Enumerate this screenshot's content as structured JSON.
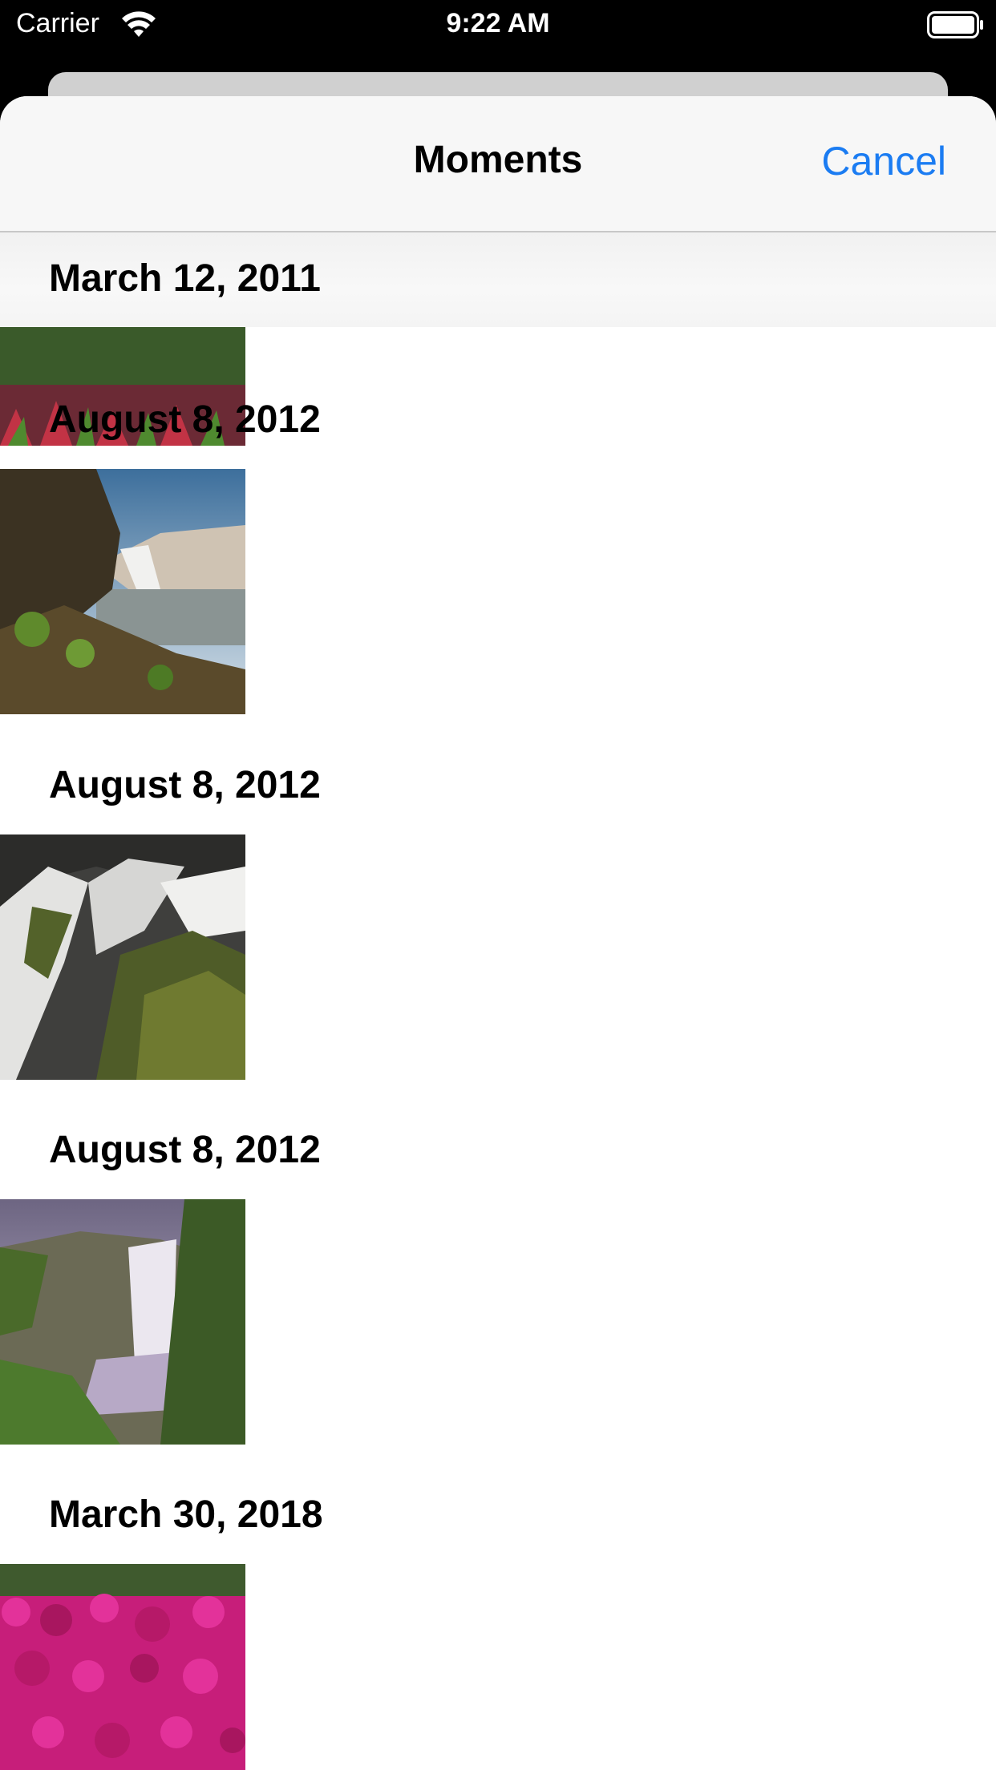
{
  "status_bar": {
    "carrier": "Carrier",
    "time": "9:22 AM",
    "wifi_icon": "wifi-icon",
    "battery_icon": "battery-full-icon"
  },
  "nav": {
    "title": "Moments",
    "cancel_label": "Cancel",
    "accent_color": "#1B7CF2"
  },
  "sections": [
    {
      "date": "March 12, 2011",
      "photo": "red-flowers-photo"
    },
    {
      "date": "August 8, 2012",
      "photo": "waterfall-cliff-photo"
    },
    {
      "date": "August 8, 2012",
      "photo": "waterfall-rocks-photo"
    },
    {
      "date": "August 8, 2012",
      "photo": "waterfall-canyon-photo"
    },
    {
      "date": "March 30, 2018",
      "photo": "magenta-flowers-photo"
    }
  ]
}
